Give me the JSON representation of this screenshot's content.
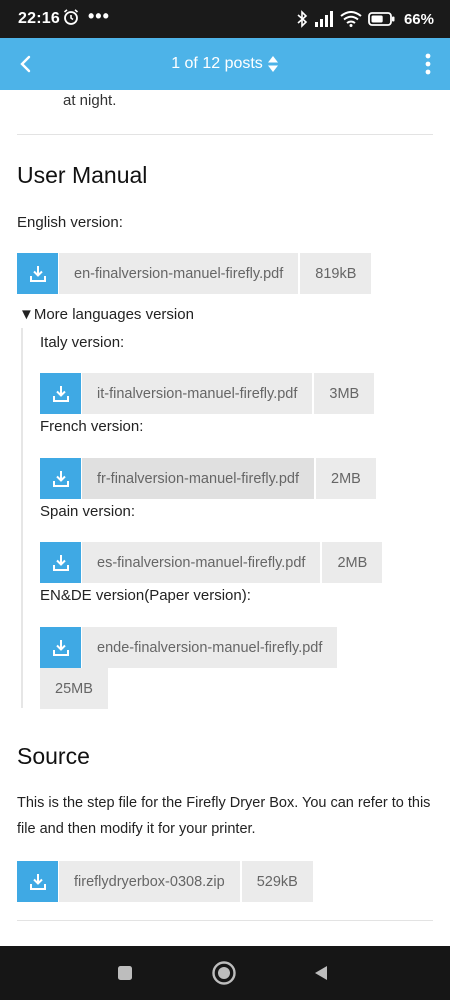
{
  "status_bar": {
    "time": "22:16",
    "dots": "•••",
    "battery_percent": "66%",
    "battery_level": 0.66
  },
  "app_bar": {
    "post_counter": "1 of 12 posts"
  },
  "content": {
    "prev_text": "at night.",
    "user_manual": {
      "heading": "User Manual",
      "english_label": "English version:",
      "english_file": {
        "name": "en-finalversion-manuel-firefly.pdf",
        "size": "819kB"
      },
      "more_languages_summary": "▼More languages version",
      "italy_label": "Italy version:",
      "italy_file": {
        "name": "it-finalversion-manuel-firefly.pdf",
        "size": "3MB"
      },
      "french_label": "French version:",
      "french_file": {
        "name": "fr-finalversion-manuel-firefly.pdf",
        "size": "2MB"
      },
      "spain_label": "Spain version:",
      "spain_file": {
        "name": "es-finalversion-manuel-firefly.pdf",
        "size": "2MB"
      },
      "ende_label": "EN&DE version(Paper version):",
      "ende_file": {
        "name": "ende-finalversion-manuel-firefly.pdf",
        "size": "25MB"
      }
    },
    "source": {
      "heading": "Source",
      "description": "This is the step file for the Firefly Dryer Box. You can refer to this file and then modify it for your printer.",
      "file": {
        "name": "fireflydryerbox-0308.zip",
        "size": "529kB"
      }
    }
  },
  "colors": {
    "app_bar": "#4db3e8",
    "download_icon_bg": "#3fa9e4",
    "file_chip_bg": "#ebebeb"
  }
}
